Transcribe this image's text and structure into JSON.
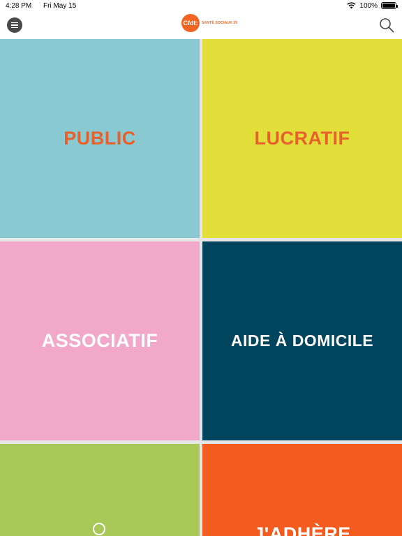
{
  "status_bar": {
    "time": "4:28 PM",
    "date": "Fri May 15",
    "battery": "100%",
    "battery_level": 1.0
  },
  "nav": {
    "logo_text": "Cfdt:",
    "logo_subtitle": "SANTÉ SOCIAUX 35",
    "menu_icon": "menu-icon",
    "search_icon": "search-icon"
  },
  "tiles": [
    {
      "label": "PUBLIC",
      "color": "#89cad2",
      "text_color": "#e8602c"
    },
    {
      "label": "LUCRATIF",
      "color": "#e2de3a",
      "text_color": "#e8602c"
    },
    {
      "label": "ASSOCIATIF",
      "color": "#f2a8c8",
      "text_color": "#ffffff"
    },
    {
      "label": "AIDE À DOMICILE",
      "color": "#01445e",
      "text_color": "#ffffff"
    },
    {
      "label": "",
      "color": "#a8c957",
      "icon": "search-icon"
    },
    {
      "label": "J'ADHÈRE",
      "color": "#f45b1f",
      "text_color": "#ffffff"
    }
  ]
}
